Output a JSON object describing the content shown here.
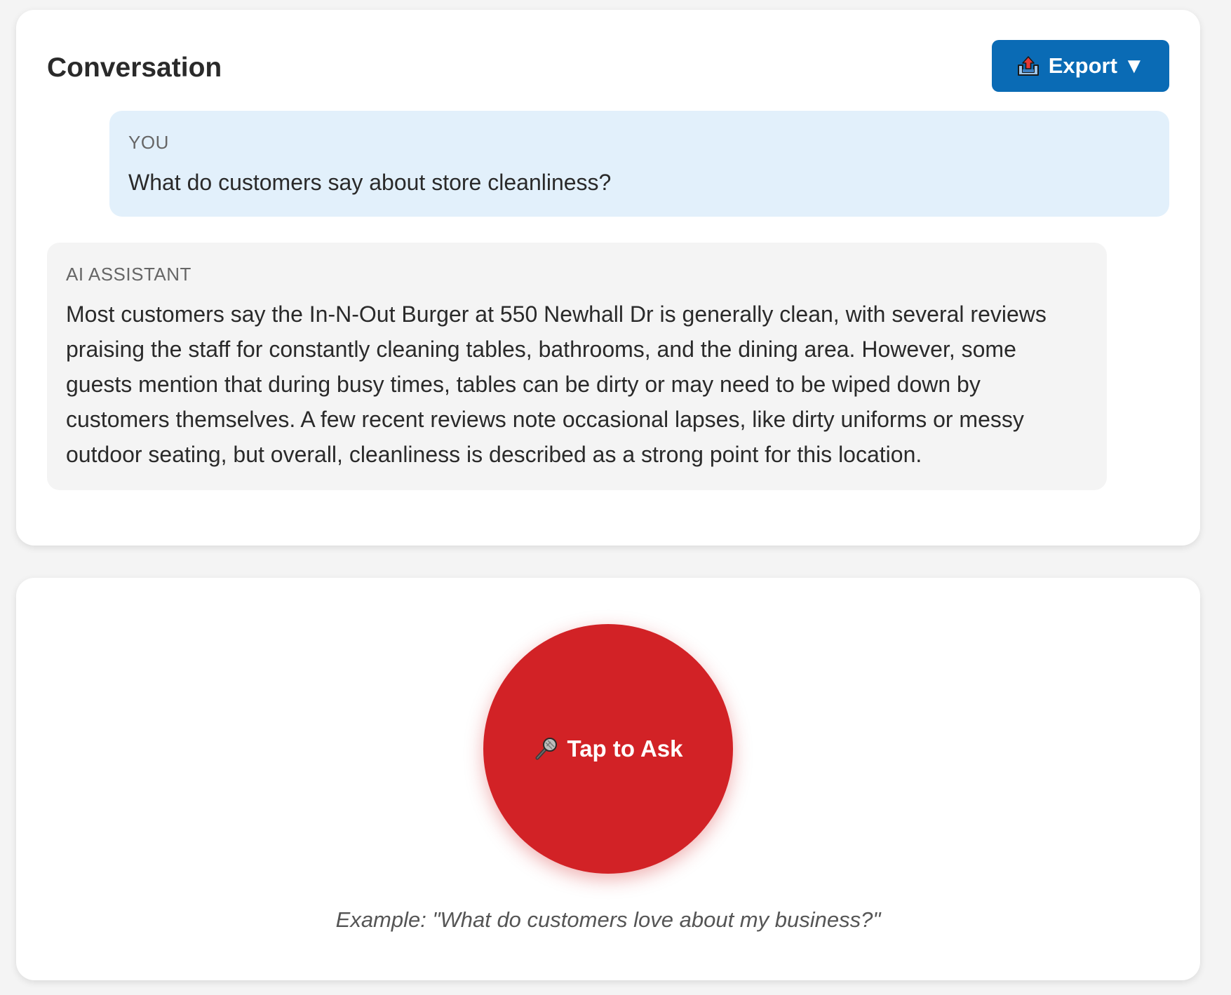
{
  "conversation": {
    "title": "Conversation",
    "export_button": {
      "label": "Export ▼",
      "icon": "export-upload-icon",
      "color": "#0a6bb5"
    },
    "messages": [
      {
        "role_label": "YOU",
        "text": "What do customers say about store cleanliness?",
        "background": "#e2f0fb"
      },
      {
        "role_label": "AI ASSISTANT",
        "text": "Most customers say the In-N-Out Burger at 550 Newhall Dr is generally clean, with several reviews praising the staff for constantly cleaning tables, bathrooms, and the dining area. However, some guests mention that during busy times, tables can be dirty or may need to be wiped down by customers themselves. A few recent reviews note occasional lapses, like dirty uniforms or messy outdoor seating, but overall, cleanliness is described as a strong point for this location.",
        "background": "#f4f4f4"
      }
    ]
  },
  "ask": {
    "button_label": "Tap to Ask",
    "button_icon": "microphone-icon",
    "button_color": "#d22226",
    "example": "Example: \"What do customers love about my business?\""
  }
}
